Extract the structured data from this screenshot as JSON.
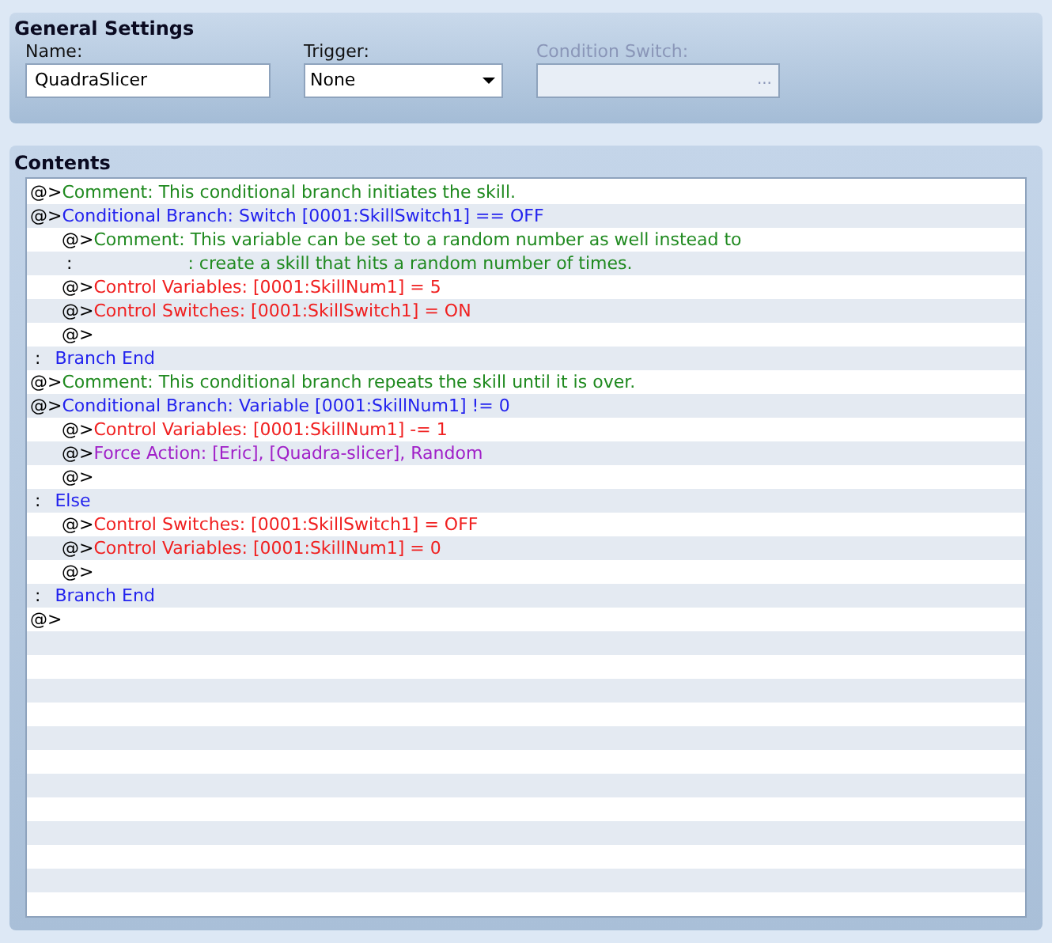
{
  "general_settings": {
    "title": "General Settings",
    "name": {
      "label": "Name:",
      "value": "QuadraSlicer"
    },
    "trigger": {
      "label": "Trigger:",
      "value": "None"
    },
    "condition_switch": {
      "label": "Condition Switch:",
      "disabled": true,
      "button": "..."
    }
  },
  "contents": {
    "title": "Contents",
    "commands": [
      {
        "prefix": "@>",
        "kind": "comment",
        "text": "Comment: This conditional branch initiates the skill."
      },
      {
        "prefix": "@>",
        "kind": "branch",
        "text": "Conditional Branch: Switch [0001:SkillSwitch1] == OFF",
        "children": [
          {
            "prefix": "@>",
            "kind": "comment",
            "text": "Comment: This variable can be set to a random number as well instead to"
          },
          {
            "prefix": ":",
            "kind": "comment_continued",
            "text": ": create a skill that hits a random number of times."
          },
          {
            "prefix": "@>",
            "kind": "control",
            "text": "Control Variables: [0001:SkillNum1] = 5"
          },
          {
            "prefix": "@>",
            "kind": "control",
            "text": "Control Switches: [0001:SkillSwitch1] = ON"
          },
          {
            "prefix": "@>",
            "kind": "empty"
          }
        ]
      },
      {
        "prefix": ":",
        "kind": "branch",
        "text": "Branch End"
      },
      {
        "prefix": "@>",
        "kind": "comment",
        "text": "Comment: This conditional branch repeats the skill until it is over."
      },
      {
        "prefix": "@>",
        "kind": "branch",
        "text": "Conditional Branch: Variable [0001:SkillNum1] != 0",
        "children": [
          {
            "prefix": "@>",
            "kind": "control",
            "text": "Control Variables: [0001:SkillNum1] -= 1"
          },
          {
            "prefix": "@>",
            "kind": "action",
            "text": "Force Action: [Eric], [Quadra-slicer], Random"
          },
          {
            "prefix": "@>",
            "kind": "empty"
          }
        ]
      },
      {
        "prefix": ":",
        "kind": "branch",
        "text": "Else",
        "children": [
          {
            "prefix": "@>",
            "kind": "control",
            "text": "Control Switches: [0001:SkillSwitch1] = OFF"
          },
          {
            "prefix": "@>",
            "kind": "control",
            "text": "Control Variables: [0001:SkillNum1] = 0"
          },
          {
            "prefix": "@>",
            "kind": "empty"
          }
        ]
      },
      {
        "prefix": ":",
        "kind": "branch",
        "text": "Branch End"
      },
      {
        "prefix": "@>",
        "kind": "empty"
      }
    ]
  }
}
